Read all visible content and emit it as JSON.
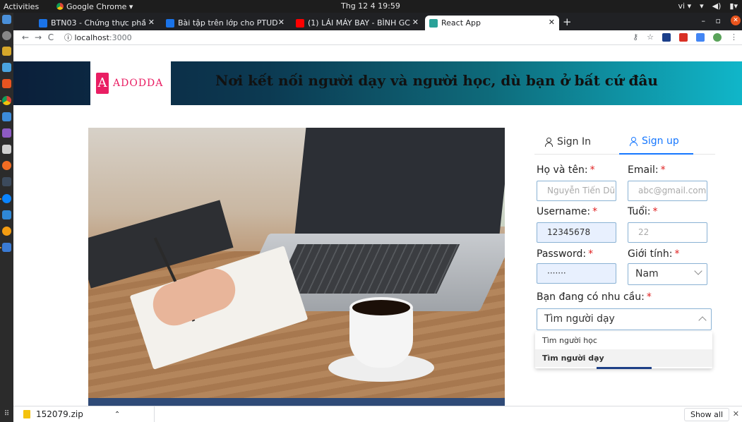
{
  "system": {
    "activities": "Activities",
    "app_menu": "Google Chrome ▾",
    "clock": "Thg 12 4  19:59",
    "lang": "vi ▾"
  },
  "browser": {
    "tabs": [
      {
        "title": "BTN03 - Chứng thực phầ",
        "color": "#1a73e8"
      },
      {
        "title": "Bài tập trên lớp cho PTUD",
        "color": "#1a73e8"
      },
      {
        "title": "(1) LÁI MÁY BAY - BÌNH GC",
        "color": "#ff0000"
      },
      {
        "title": "React App",
        "color": "#2aa198"
      }
    ],
    "url_host": "localhost",
    "url_port": ":3000"
  },
  "header": {
    "logo_text": "ADODDA",
    "tagline": "Nơi kết nối người dạy và người học, dù bạn ở bất cứ đâu"
  },
  "auth": {
    "tab_signin": "Sign In",
    "tab_signup": "Sign up",
    "fullname_label": "Họ và tên:",
    "fullname_placeholder": "Nguyễn Tiến Dũng",
    "email_label": "Email:",
    "email_placeholder": "abc@gmail.com",
    "username_label": "Username:",
    "username_value": "12345678",
    "age_label": "Tuổi:",
    "age_placeholder": "22",
    "password_label": "Password:",
    "password_value": "·······",
    "gender_label": "Giới tính:",
    "gender_value": "Nam",
    "need_label": "Bạn đang có nhu cầu:",
    "need_value": "Tìm người dạy",
    "need_options": [
      "Tìm người học",
      "Tìm người dạy"
    ],
    "required_mark": "*"
  },
  "downloads": {
    "file": "152079.zip",
    "show_all": "Show all"
  }
}
